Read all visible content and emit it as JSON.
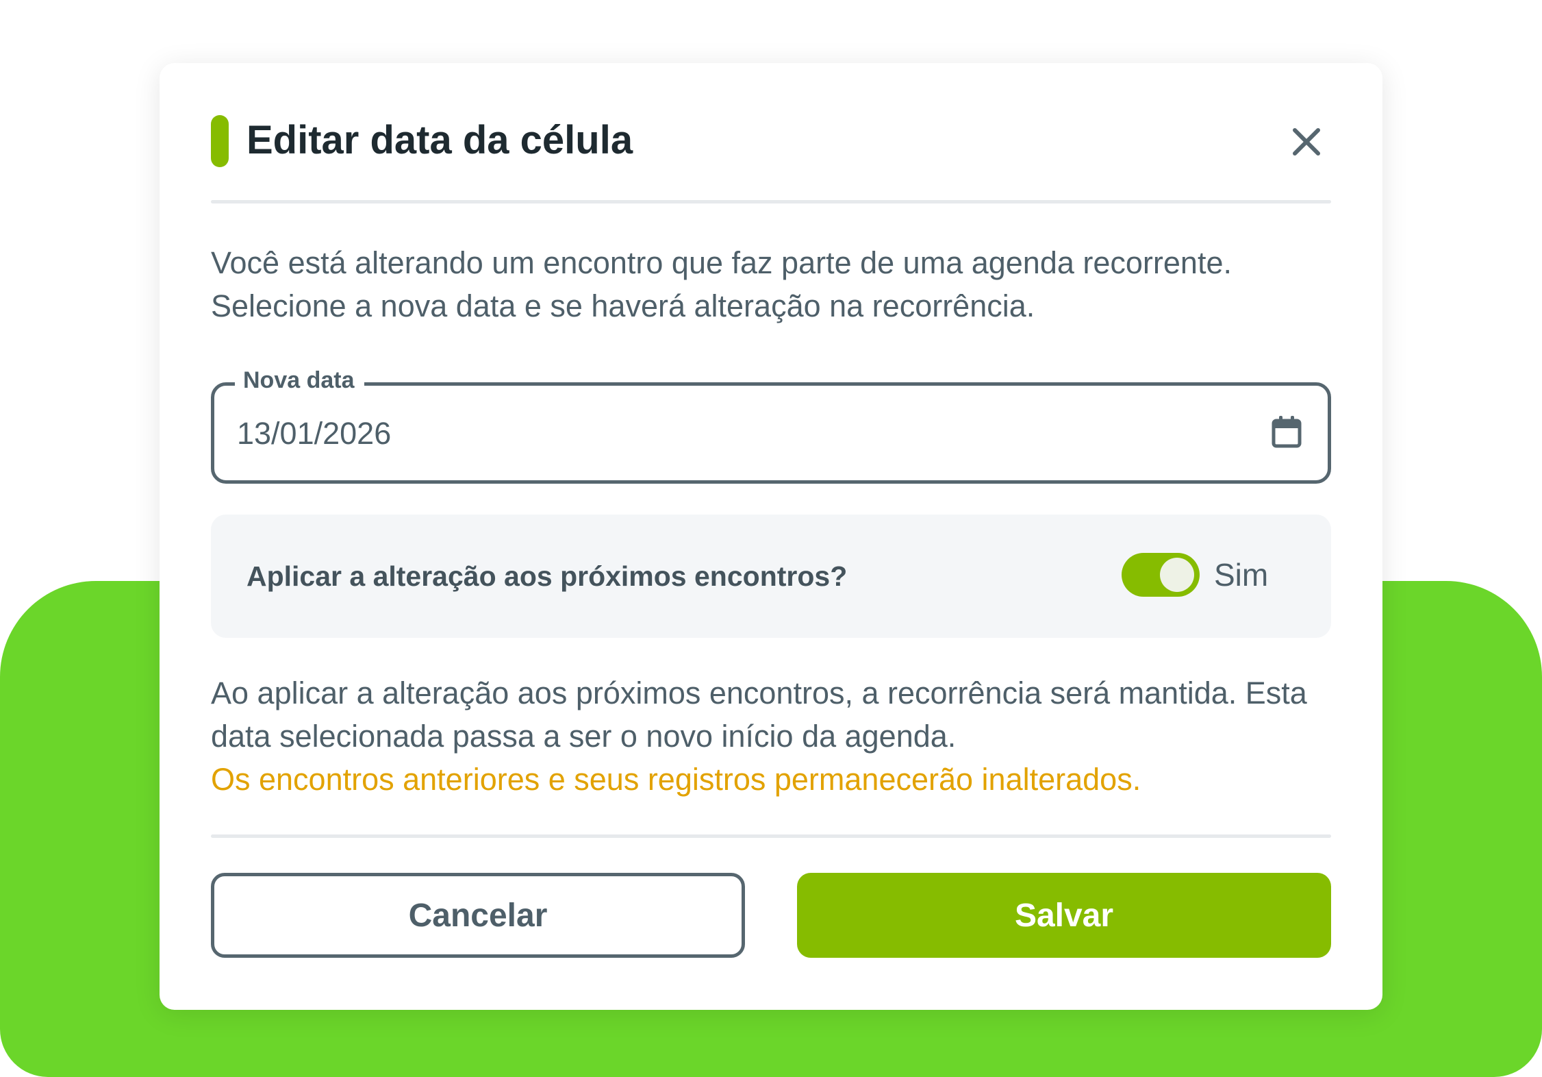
{
  "colors": {
    "accent": "#86bc00",
    "background_brand": "#6bd62a",
    "warning_text": "#e2a200",
    "body_text": "#4e5f69",
    "title_text": "#1e2a30"
  },
  "modal": {
    "title": "Editar data da célula",
    "close_icon": "close-icon",
    "intro_text": "Você está alterando um encontro que faz parte de uma agenda recorrente. Selecione a nova data e se haverá alteração na recorrência.",
    "date_field": {
      "label": "Nova data",
      "value": "13/01/2026",
      "icon": "calendar-icon"
    },
    "apply_option": {
      "question": "Aplicar a alteração aos próximos encontros?",
      "toggle_on": true,
      "toggle_label": "Sim"
    },
    "info_text": "Ao aplicar a alteração aos próximos encontros, a recorrência será mantida. Esta data selecionada passa a ser o novo início da agenda.",
    "warning_text": "Os encontros anteriores e seus registros permanecerão inalterados.",
    "buttons": {
      "cancel_label": "Cancelar",
      "save_label": "Salvar"
    }
  }
}
